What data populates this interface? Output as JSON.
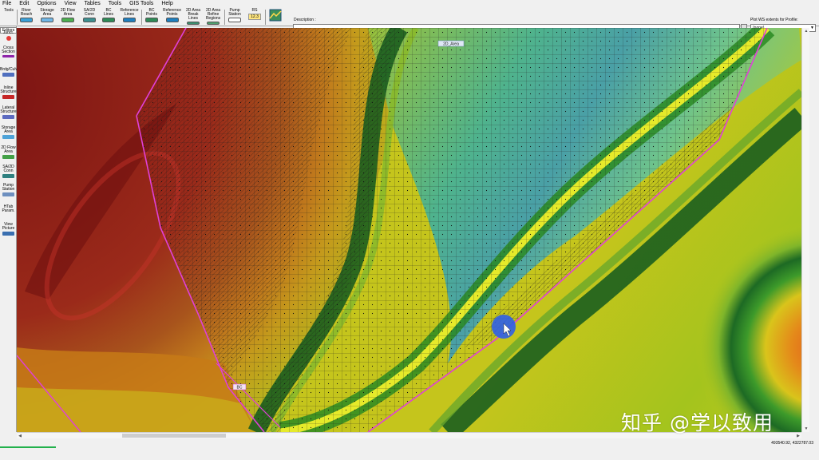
{
  "menu": [
    "File",
    "Edit",
    "Options",
    "View",
    "Tables",
    "Tools",
    "GIS Tools",
    "Help"
  ],
  "toolbar": {
    "buttons": [
      "Tools",
      "River Reach",
      "Storage Area",
      "2D Flow Area",
      "SA/2D Conn",
      "BC Lines",
      "Reference Lines",
      "BC Points",
      "Reference Points",
      "2D Area Break Lines",
      "2D Area Refine Regions",
      "Pump Station",
      "RS"
    ],
    "rs_value": "12.3",
    "description_label": "Description :",
    "description_value": "",
    "description_button": "...",
    "plot_ws_label": "Plot WS extents for Profile:",
    "plot_ws_value": "(none)"
  },
  "palette": {
    "tab": "Editors",
    "items": [
      "Junct.",
      "Cross Section",
      "Brdg/Culv",
      "Inline Structure",
      "Lateral Structure",
      "Storage Area",
      "2D Flow Area",
      "SA/2D Conn",
      "Pump Station",
      "HTab Param.",
      "View Picture"
    ]
  },
  "map": {
    "labels": {
      "area_name": "2D_Area",
      "bc_name": "BC"
    },
    "colors": {
      "boundary": "#e040d8",
      "cursor": "#2f5fe8",
      "grid": "#1c1c1c"
    }
  },
  "status": {
    "coordinates": "493540.92, 4322787.03"
  },
  "watermark": "知乎 @学以致用"
}
